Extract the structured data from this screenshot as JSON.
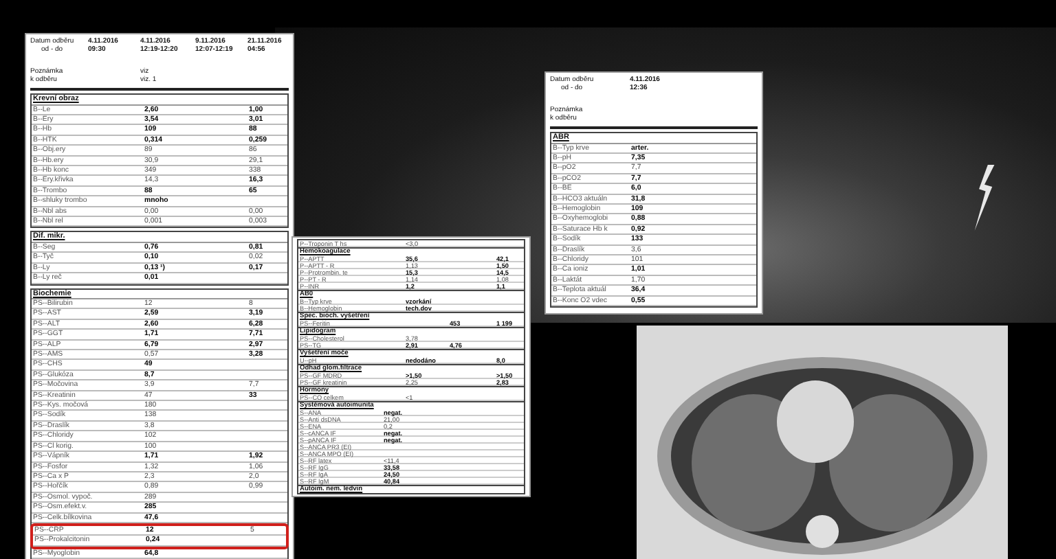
{
  "background_photo": {
    "kind": "storm"
  },
  "sheets": [
    {
      "header": {
        "date_label": "Datum odběru",
        "time_label": "od - do",
        "note_label": "Poznámka k odběru",
        "columns": [
          {
            "date": "4.11.2016",
            "time": "09:30"
          },
          {
            "date": "4.11.2016",
            "time": "12:19-12:20",
            "note": "viz",
            "note_2": "viz. 1"
          },
          {
            "date": "9.11.2016",
            "time": "12:07-12:19"
          },
          {
            "date": "21.11.2016",
            "time": "04:56"
          }
        ]
      },
      "sections": [
        {
          "title": "Krevní obraz",
          "rows": [
            {
              "name": "B--Le",
              "col_2": {
                "text": "2,60",
                "bold": true
              },
              "col_4": {
                "text": "1,00",
                "bold": true
              }
            },
            {
              "name": "B--Ery",
              "col_2": {
                "text": "3,54",
                "bold": true
              },
              "col_4": {
                "text": "3,01",
                "bold": true
              }
            },
            {
              "name": "B--Hb",
              "col_2": {
                "text": "109",
                "bold": true
              },
              "col_4": {
                "text": "88",
                "bold": true
              }
            },
            {
              "name": "B--HTK",
              "col_2": {
                "text": "0,314",
                "bold": true
              },
              "col_4": {
                "text": "0,259",
                "bold": true
              }
            },
            {
              "name": "B--Obj.ery",
              "col_2": {
                "text": "89",
                "bold": false
              },
              "col_4": {
                "text": "86",
                "bold": false
              }
            },
            {
              "name": "B--Hb.ery",
              "col_2": {
                "text": "30,9",
                "bold": false
              },
              "col_4": {
                "text": "29,1",
                "bold": false
              }
            },
            {
              "name": "B--Hb konc",
              "col_2": {
                "text": "349",
                "bold": false
              },
              "col_4": {
                "text": "338",
                "bold": false
              }
            },
            {
              "name": "B--Ery.křivka",
              "col_2": {
                "text": "14,3",
                "bold": false
              },
              "col_4": {
                "text": "16,3",
                "bold": true
              }
            },
            {
              "name": "B--Trombo",
              "col_2": {
                "text": "88",
                "bold": true
              },
              "col_4": {
                "text": "65",
                "bold": true
              }
            },
            {
              "name": "B--shluky trombo",
              "col_2": {
                "text": "mnoho",
                "bold": true
              }
            },
            {
              "name": "B--Nbl abs",
              "col_2": {
                "text": "0,00",
                "bold": false
              },
              "col_4": {
                "text": "0,00",
                "bold": false
              }
            },
            {
              "name": "B--Nbl rel",
              "col_2": {
                "text": "0,001",
                "bold": false
              },
              "col_4": {
                "text": "0,003",
                "bold": false
              }
            }
          ]
        },
        {
          "title": "Dif. mikr.",
          "rows": [
            {
              "name": "B--Seg",
              "col_2": {
                "text": "0,76",
                "bold": true
              },
              "col_4": {
                "text": "0,81",
                "bold": true
              }
            },
            {
              "name": "B--Tyč",
              "col_2": {
                "text": "0,10",
                "bold": true
              },
              "col_4": {
                "text": "0,02",
                "bold": false
              }
            },
            {
              "name": "B--Ly",
              "col_2": {
                "text": "0,13 ¹)",
                "bold": true
              },
              "col_4": {
                "text": "0,17",
                "bold": true
              }
            },
            {
              "name": "B--Ly reč",
              "col_2": {
                "text": "0,01",
                "bold": true
              }
            }
          ]
        },
        {
          "title": "Biochemie",
          "rows": [
            {
              "name": "PS--Bilirubin",
              "col_2": {
                "text": "12",
                "bold": false
              },
              "col_4": {
                "text": "8",
                "bold": false
              }
            },
            {
              "name": "PS--AST",
              "col_2": {
                "text": "2,59",
                "bold": true
              },
              "col_4": {
                "text": "3,19",
                "bold": true
              }
            },
            {
              "name": "PS--ALT",
              "col_2": {
                "text": "2,60",
                "bold": true
              },
              "col_4": {
                "text": "6,28",
                "bold": true
              }
            },
            {
              "name": "PS--GGT",
              "col_2": {
                "text": "1,71",
                "bold": true
              },
              "col_4": {
                "text": "7,71",
                "bold": true
              }
            },
            {
              "name": "PS--ALP",
              "col_2": {
                "text": "6,79",
                "bold": true
              },
              "col_4": {
                "text": "2,97",
                "bold": true
              }
            },
            {
              "name": "PS--AMS",
              "col_2": {
                "text": "0,57",
                "bold": false
              },
              "col_4": {
                "text": "3,28",
                "bold": true
              }
            },
            {
              "name": "PS--CHS",
              "col_2": {
                "text": "49",
                "bold": true
              }
            },
            {
              "name": "PS--Glukóza",
              "col_2": {
                "text": "8,7",
                "bold": true
              }
            },
            {
              "name": "PS--Močovina",
              "col_2": {
                "text": "3,9",
                "bold": false
              },
              "col_4": {
                "text": "7,7",
                "bold": false
              }
            },
            {
              "name": "PS--Kreatinin",
              "col_2": {
                "text": "47",
                "bold": false
              },
              "col_4": {
                "text": "33",
                "bold": true
              }
            },
            {
              "name": "PS--Kys. močová",
              "col_2": {
                "text": "180",
                "bold": false
              }
            },
            {
              "name": "PS--Sodík",
              "col_2": {
                "text": "138",
                "bold": false
              }
            },
            {
              "name": "PS--Draslík",
              "col_2": {
                "text": "3,8",
                "bold": false
              }
            },
            {
              "name": "PS--Chloridy",
              "col_2": {
                "text": "102",
                "bold": false
              }
            },
            {
              "name": "PS--Cl korig.",
              "col_2": {
                "text": "100",
                "bold": false
              }
            },
            {
              "name": "PS--Vápník",
              "col_2": {
                "text": "1,71",
                "bold": true
              },
              "col_4": {
                "text": "1,92",
                "bold": true
              }
            },
            {
              "name": "PS--Fosfor",
              "col_2": {
                "text": "1,32",
                "bold": false
              },
              "col_4": {
                "text": "1,06",
                "bold": false
              }
            },
            {
              "name": "PS--Ca x P",
              "col_2": {
                "text": "2,3",
                "bold": false
              },
              "col_4": {
                "text": "2,0",
                "bold": false
              }
            },
            {
              "name": "PS--Hořčík",
              "col_2": {
                "text": "0,89",
                "bold": false
              },
              "col_4": {
                "text": "0,99",
                "bold": false
              }
            },
            {
              "name": "PS--Osmol. vypoč.",
              "col_2": {
                "text": "289",
                "bold": false
              }
            },
            {
              "name": "PS--Osm.efekt.v.",
              "col_2": {
                "text": "285",
                "bold": true
              }
            },
            {
              "name": "PS--Celk.bílkovina",
              "col_2": {
                "text": "47,6",
                "bold": true
              }
            },
            {
              "name": "PS--CRP",
              "highlighted": true,
              "col_2": {
                "text": "12",
                "bold": true
              },
              "col_4": {
                "text": "5",
                "bold": false
              }
            },
            {
              "name": "PS--Prokalcitonin",
              "highlighted": true,
              "col_2": {
                "text": "0,24",
                "bold": true
              }
            },
            {
              "name": "PS--Myoglobin",
              "col_2": {
                "text": "64,8",
                "bold": true
              }
            }
          ]
        }
      ]
    },
    {
      "sections": [
        {
          "rows": [
            {
              "name": "P--Troponin T hs",
              "col_2": {
                "text": "<3,0",
                "bold": false
              }
            }
          ]
        },
        {
          "title": "Hemokoagulace",
          "rows": [
            {
              "name": "P--APTT",
              "col_2": {
                "text": "35,6",
                "bold": true
              },
              "col_4": {
                "text": "42,1",
                "bold": true
              }
            },
            {
              "name": "P--APTT - R",
              "col_2": {
                "text": "1,13",
                "bold": false
              },
              "col_4": {
                "text": "1,50",
                "bold": true
              }
            },
            {
              "name": "P--Protrombin. te",
              "col_2": {
                "text": "15,3",
                "bold": true
              },
              "col_4": {
                "text": "14,5",
                "bold": true
              }
            },
            {
              "name": "P--PT - R",
              "col_2": {
                "text": "1,14",
                "bold": false
              },
              "col_4": {
                "text": "1,08",
                "bold": false
              }
            },
            {
              "name": "P--INR",
              "col_2": {
                "text": "1,2",
                "bold": true
              },
              "col_4": {
                "text": "1,1",
                "bold": true
              }
            }
          ]
        },
        {
          "title": "AB0",
          "rows": [
            {
              "name": "B--Typ krve",
              "col_2": {
                "text": "vzorkání",
                "bold": true
              }
            },
            {
              "name": "B--Hemoglobin",
              "col_2": {
                "text": "tech.dov",
                "bold": true
              }
            }
          ]
        },
        {
          "title": "Spec. bioch. vyšetření",
          "rows": [
            {
              "name": "PS--Feritin",
              "col_3": {
                "text": "453",
                "bold": true
              },
              "col_4": {
                "text": "1 199",
                "bold": true
              }
            }
          ]
        },
        {
          "title": "Lipidogram",
          "rows": [
            {
              "name": "PS--Cholesterol",
              "col_2": {
                "text": "3,78",
                "bold": false
              }
            },
            {
              "name": "PS--TG",
              "col_2": {
                "text": "2,91",
                "bold": true
              },
              "col_3": {
                "text": "4,76",
                "bold": true
              }
            }
          ]
        },
        {
          "title": "Vyšetření moče",
          "rows": [
            {
              "name": "U--pH",
              "col_2": {
                "text": "nedodáno",
                "bold": true
              },
              "col_4": {
                "text": "8,0",
                "bold": true
              }
            }
          ]
        },
        {
          "title": "Odhad glom.filtrace",
          "rows": [
            {
              "name": "PS--GF MDRD",
              "col_2": {
                "text": ">1,50",
                "bold": true
              },
              "col_4": {
                "text": ">1,50",
                "bold": true
              }
            },
            {
              "name": "PS--GF kreatinin",
              "col_2": {
                "text": "2,25",
                "bold": false
              },
              "col_4": {
                "text": "2,83",
                "bold": true
              }
            }
          ]
        },
        {
          "title": "Hormony",
          "rows": [
            {
              "name": "PS--CO celkem",
              "col_2": {
                "text": "<1",
                "bold": false
              }
            }
          ]
        },
        {
          "title": "Systémová autoimunita",
          "rows": [
            {
              "name": "S--ANA",
              "col_1": {
                "text": "negat.",
                "bold": true
              }
            },
            {
              "name": "S--Anti dsDNA",
              "col_1": {
                "text": "21,00",
                "bold": false
              }
            },
            {
              "name": "S--ENA",
              "col_1": {
                "text": "0,2",
                "bold": false
              }
            },
            {
              "name": "S--cANCA IF",
              "col_1": {
                "text": "negat.",
                "bold": true
              }
            },
            {
              "name": "S--pANCA IF",
              "col_1": {
                "text": "negat.",
                "bold": true
              }
            },
            {
              "name": "S--ANCA PR3 (EI)"
            },
            {
              "name": "S--ANCA MPO (EI)"
            },
            {
              "name": "S--RF latex",
              "col_1": {
                "text": "<11,4",
                "bold": false
              }
            },
            {
              "name": "S--RF IgG",
              "col_1": {
                "text": "33,58",
                "bold": true
              }
            },
            {
              "name": "S--RF IgA",
              "col_1": {
                "text": "24,50",
                "bold": true
              }
            },
            {
              "name": "S--RF IgM",
              "col_1": {
                "text": "40,84",
                "bold": true
              }
            }
          ]
        },
        {
          "title": "Autoim. nem. ledvin"
        }
      ]
    },
    {
      "header": {
        "date_label": "Datum odběru",
        "time_label": "od - do",
        "note_label": "Poznámka k odběru",
        "columns": [
          {
            "date": "4.11.2016",
            "time": "12:36"
          }
        ]
      },
      "sections": [
        {
          "title": "ABR",
          "rows": [
            {
              "name": "B--Typ krve",
              "col_1": {
                "text": "arter.",
                "bold": true
              }
            },
            {
              "name": "B--pH",
              "col_1": {
                "text": "7,35",
                "bold": true
              }
            },
            {
              "name": "B--pO2",
              "col_1": {
                "text": "7,7",
                "bold": false
              }
            },
            {
              "name": "B--pCO2",
              "col_1": {
                "text": "7,7",
                "bold": true
              }
            },
            {
              "name": "B--BE",
              "col_1": {
                "text": "6,0",
                "bold": true
              }
            },
            {
              "name": "B--HCO3 aktuáln",
              "col_1": {
                "text": "31,8",
                "bold": true
              }
            },
            {
              "name": "B--Hemoglobin",
              "col_1": {
                "text": "109",
                "bold": true
              }
            },
            {
              "name": "B--Oxyhemoglobi",
              "col_1": {
                "text": "0,88",
                "bold": true
              }
            },
            {
              "name": "B--Saturace Hb k",
              "col_1": {
                "text": "0,92",
                "bold": true
              }
            },
            {
              "name": "B--Sodík",
              "col_1": {
                "text": "133",
                "bold": true
              }
            },
            {
              "name": "B--Draslík",
              "col_1": {
                "text": "3,6",
                "bold": false
              }
            },
            {
              "name": "B--Chloridy",
              "col_1": {
                "text": "101",
                "bold": false
              }
            },
            {
              "name": "B--Ca ioniz",
              "col_1": {
                "text": "1,01",
                "bold": true
              }
            },
            {
              "name": "B--Laktát",
              "col_1": {
                "text": "1,70",
                "bold": false
              }
            },
            {
              "name": "B--Teplota aktuál",
              "col_1": {
                "text": "36,4",
                "bold": true
              }
            },
            {
              "name": "B--Konc O2 vdec",
              "col_1": {
                "text": "0,55",
                "bold": true
              }
            }
          ]
        }
      ]
    }
  ],
  "ct_image": {
    "kind": "chest-ct"
  }
}
